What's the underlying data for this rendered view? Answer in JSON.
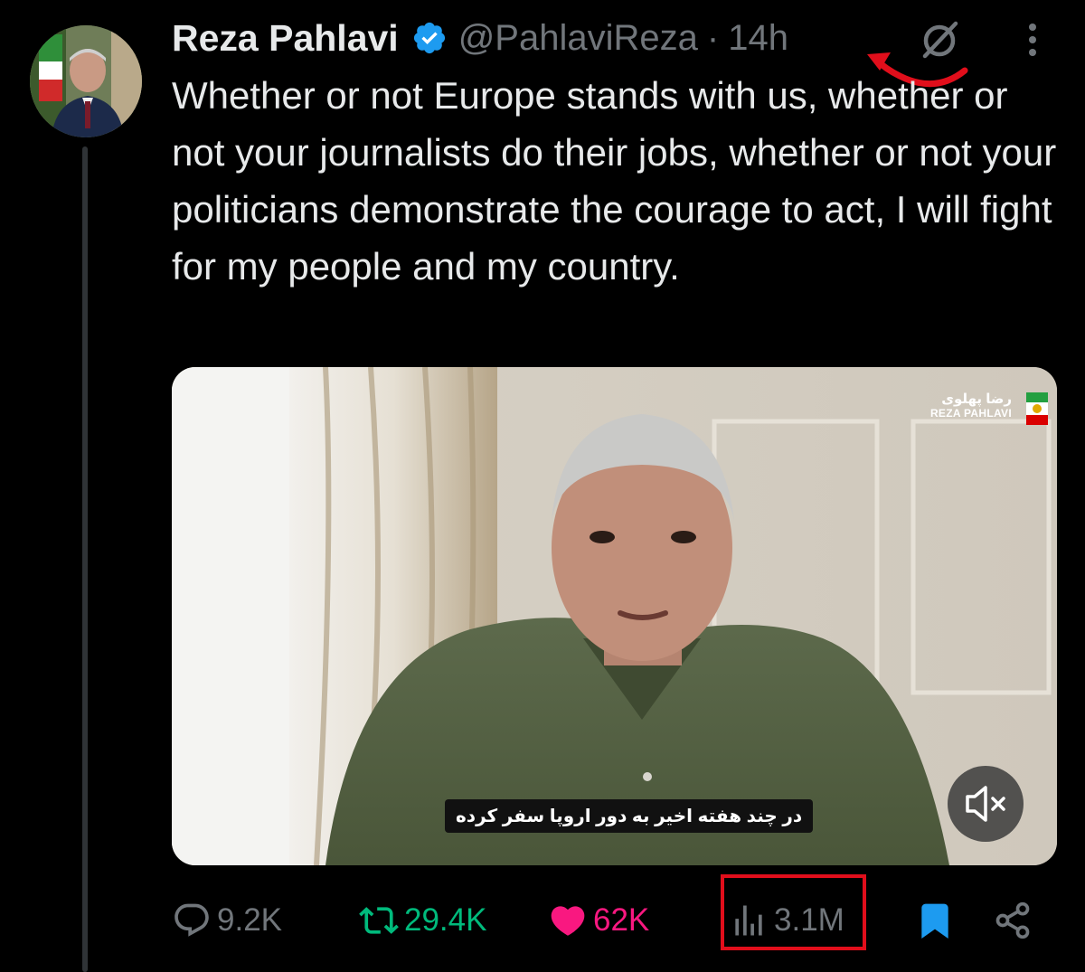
{
  "tweet": {
    "author_name": "Reza Pahlavi",
    "handle": "@PahlaviReza",
    "separator": "·",
    "timestamp": "14h",
    "text": "Whether or not Europe stands with us, whether or not your journalists do their jobs, whether or not your politicians demonstrate the courage to act, I will fight for my people and my country."
  },
  "media": {
    "watermark_fa": "رضا پهلوی",
    "watermark_en": "REZA PAHLAVI",
    "subtitle": "در چند هفته اخیر به دور اروپا سفر کرده"
  },
  "actions": {
    "replies": "9.2K",
    "retweets": "29.4K",
    "likes": "62K",
    "views": "3.1M"
  },
  "colors": {
    "background": "#000000",
    "text": "#e7e9ea",
    "muted": "#71767b",
    "verified": "#1d9bf0",
    "retweet": "#00ba7c",
    "like": "#f91880",
    "bookmark": "#1d9bf0",
    "annotation": "#e10e1b"
  },
  "icons": [
    "verified-badge-icon",
    "grok-icon",
    "more-icon",
    "reply-icon",
    "retweet-icon",
    "heart-icon",
    "views-icon",
    "bookmark-icon",
    "share-icon",
    "mute-icon"
  ]
}
